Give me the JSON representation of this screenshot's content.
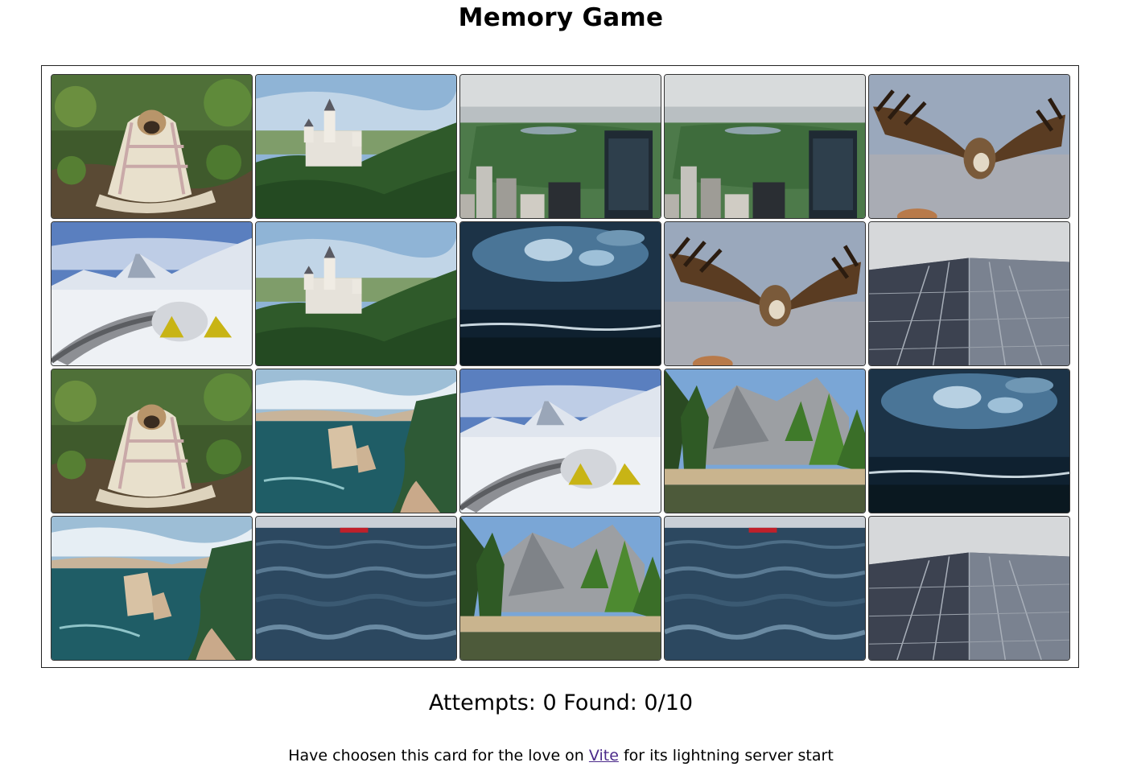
{
  "title": "Memory Game",
  "cards": [
    {
      "image": "pug-in-blanket"
    },
    {
      "image": "castle-on-hill"
    },
    {
      "image": "city-park-aerial"
    },
    {
      "image": "city-park-aerial"
    },
    {
      "image": "vulture-flying"
    },
    {
      "image": "snowy-mountain-camp"
    },
    {
      "image": "castle-on-hill"
    },
    {
      "image": "stormy-sea-clouds"
    },
    {
      "image": "vulture-flying"
    },
    {
      "image": "skyscraper-looking-up"
    },
    {
      "image": "pug-in-blanket"
    },
    {
      "image": "coastal-cliffs"
    },
    {
      "image": "snowy-mountain-camp"
    },
    {
      "image": "valley-forest-river"
    },
    {
      "image": "stormy-sea-clouds"
    },
    {
      "image": "coastal-cliffs"
    },
    {
      "image": "ocean-waves-boat"
    },
    {
      "image": "valley-forest-river"
    },
    {
      "image": "ocean-waves-boat"
    },
    {
      "image": "skyscraper-looking-up"
    }
  ],
  "stats": {
    "attempts_label": "Attempts:",
    "attempts_value": "0",
    "found_label": "Found:",
    "found_value": "0/10"
  },
  "footer": {
    "prefix": "Have choosen this card for the love on",
    "link_text": "Vite",
    "suffix": "for its lightning server start"
  }
}
